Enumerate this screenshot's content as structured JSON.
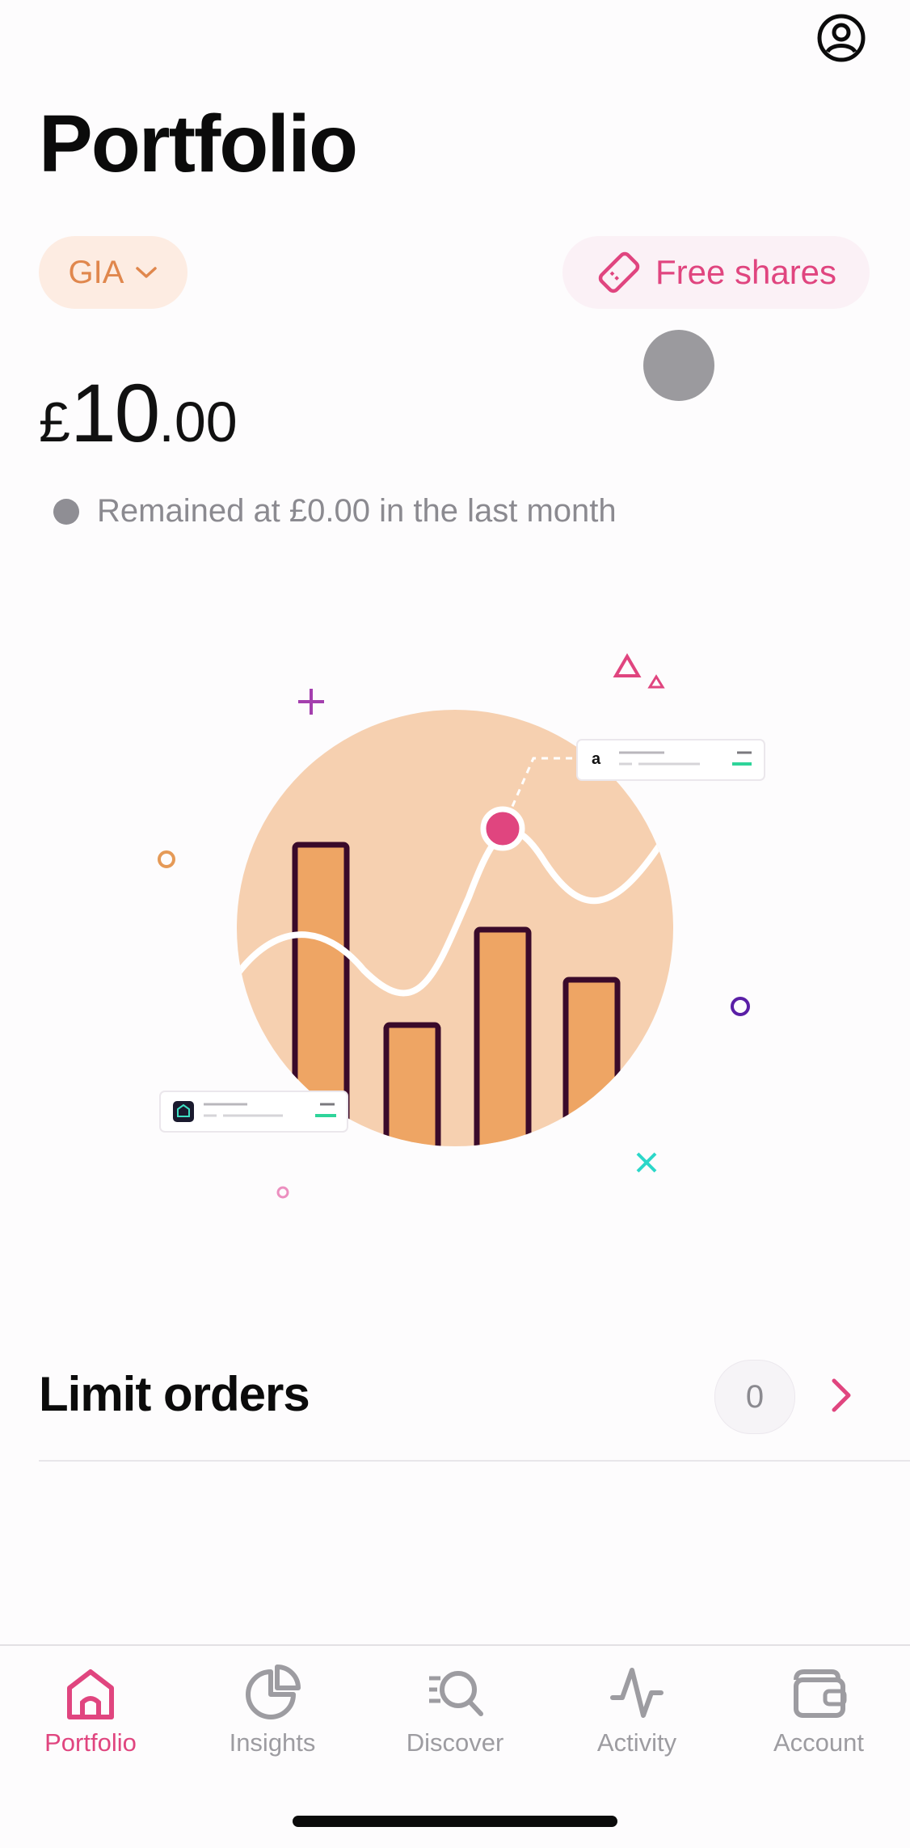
{
  "header": {
    "title": "Portfolio",
    "account_type": "GIA",
    "promo_label": "Free shares"
  },
  "balance": {
    "currency": "£",
    "whole": "10",
    "decimal": ".00",
    "change_text": "Remained at £0.00 in the last month"
  },
  "illustration": {
    "card_logo_letter": "a"
  },
  "limit_orders": {
    "title": "Limit orders",
    "count": "0"
  },
  "nav": {
    "items": [
      {
        "label": "Portfolio",
        "icon": "home-icon",
        "active": true
      },
      {
        "label": "Insights",
        "icon": "pie-chart-icon",
        "active": false
      },
      {
        "label": "Discover",
        "icon": "search-list-icon",
        "active": false
      },
      {
        "label": "Activity",
        "icon": "pulse-icon",
        "active": false
      },
      {
        "label": "Account",
        "icon": "wallet-icon",
        "active": false
      }
    ]
  },
  "colors": {
    "accent": "#e0457f",
    "gia": "#e0874d",
    "muted": "#8b8a90"
  }
}
